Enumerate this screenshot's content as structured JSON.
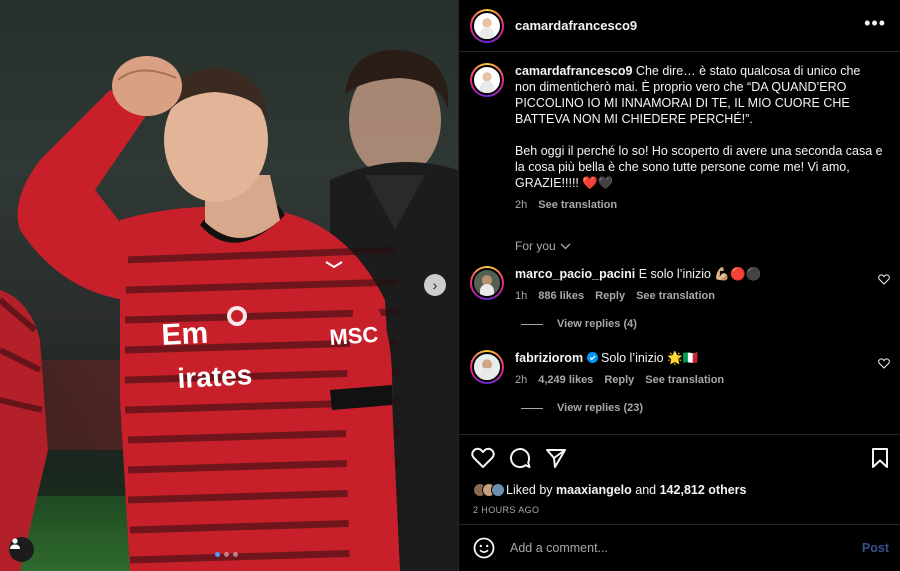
{
  "header": {
    "username": "camardafrancesco9",
    "more_icon": "more-horizontal-icon"
  },
  "caption": {
    "username": "camardafrancesco9",
    "text_1": "Che dire… è stato qualcosa di unico che non dimenticherò mai. È proprio vero che “DA QUAND’ERO PICCOLINO IO MI INNAMORAI DI TE, IL MIO CUORE CHE BATTEVA NON MI CHIEDERE PERCHÉ!”.",
    "text_2": "Beh oggi il perché lo so! Ho scoperto di avere una seconda casa e la cosa più bella è che sono tutte persone come me! Vi amo, GRAZIE!!!!! ❤️🖤",
    "time": "2h",
    "see_translation": "See translation"
  },
  "for_you": "For you",
  "comments": [
    {
      "username": "marco_pacio_pacini",
      "text": "E solo l’inizio 💪🏼🔴⚫",
      "time": "1h",
      "likes": "886 likes",
      "reply": "Reply",
      "see_translation": "See translation",
      "view_replies": "View replies (4)",
      "verified": false
    },
    {
      "username": "fabriziorom",
      "text": "Solo l’inizio 🌟🇮🇹",
      "time": "2h",
      "likes": "4,249 likes",
      "reply": "Reply",
      "see_translation": "See translation",
      "view_replies": "View replies (23)",
      "verified": true
    }
  ],
  "likes": {
    "liked_by_prefix": "Liked by",
    "liked_by_user": "maaxiangelo",
    "and": "and",
    "others": "142,812 others"
  },
  "timestamp": "2 HOURS AGO",
  "add_comment": {
    "placeholder": "Add a comment...",
    "post": "Post"
  },
  "colors": {
    "accent_blue": "#0095f6",
    "jersey_red": "#c8202a",
    "background": "#000000"
  },
  "photo": {
    "jersey_sponsor": "Fly Emirates",
    "jersey_sleeve_sponsor": "MSC",
    "carousel_position": 1,
    "carousel_count": 3
  }
}
